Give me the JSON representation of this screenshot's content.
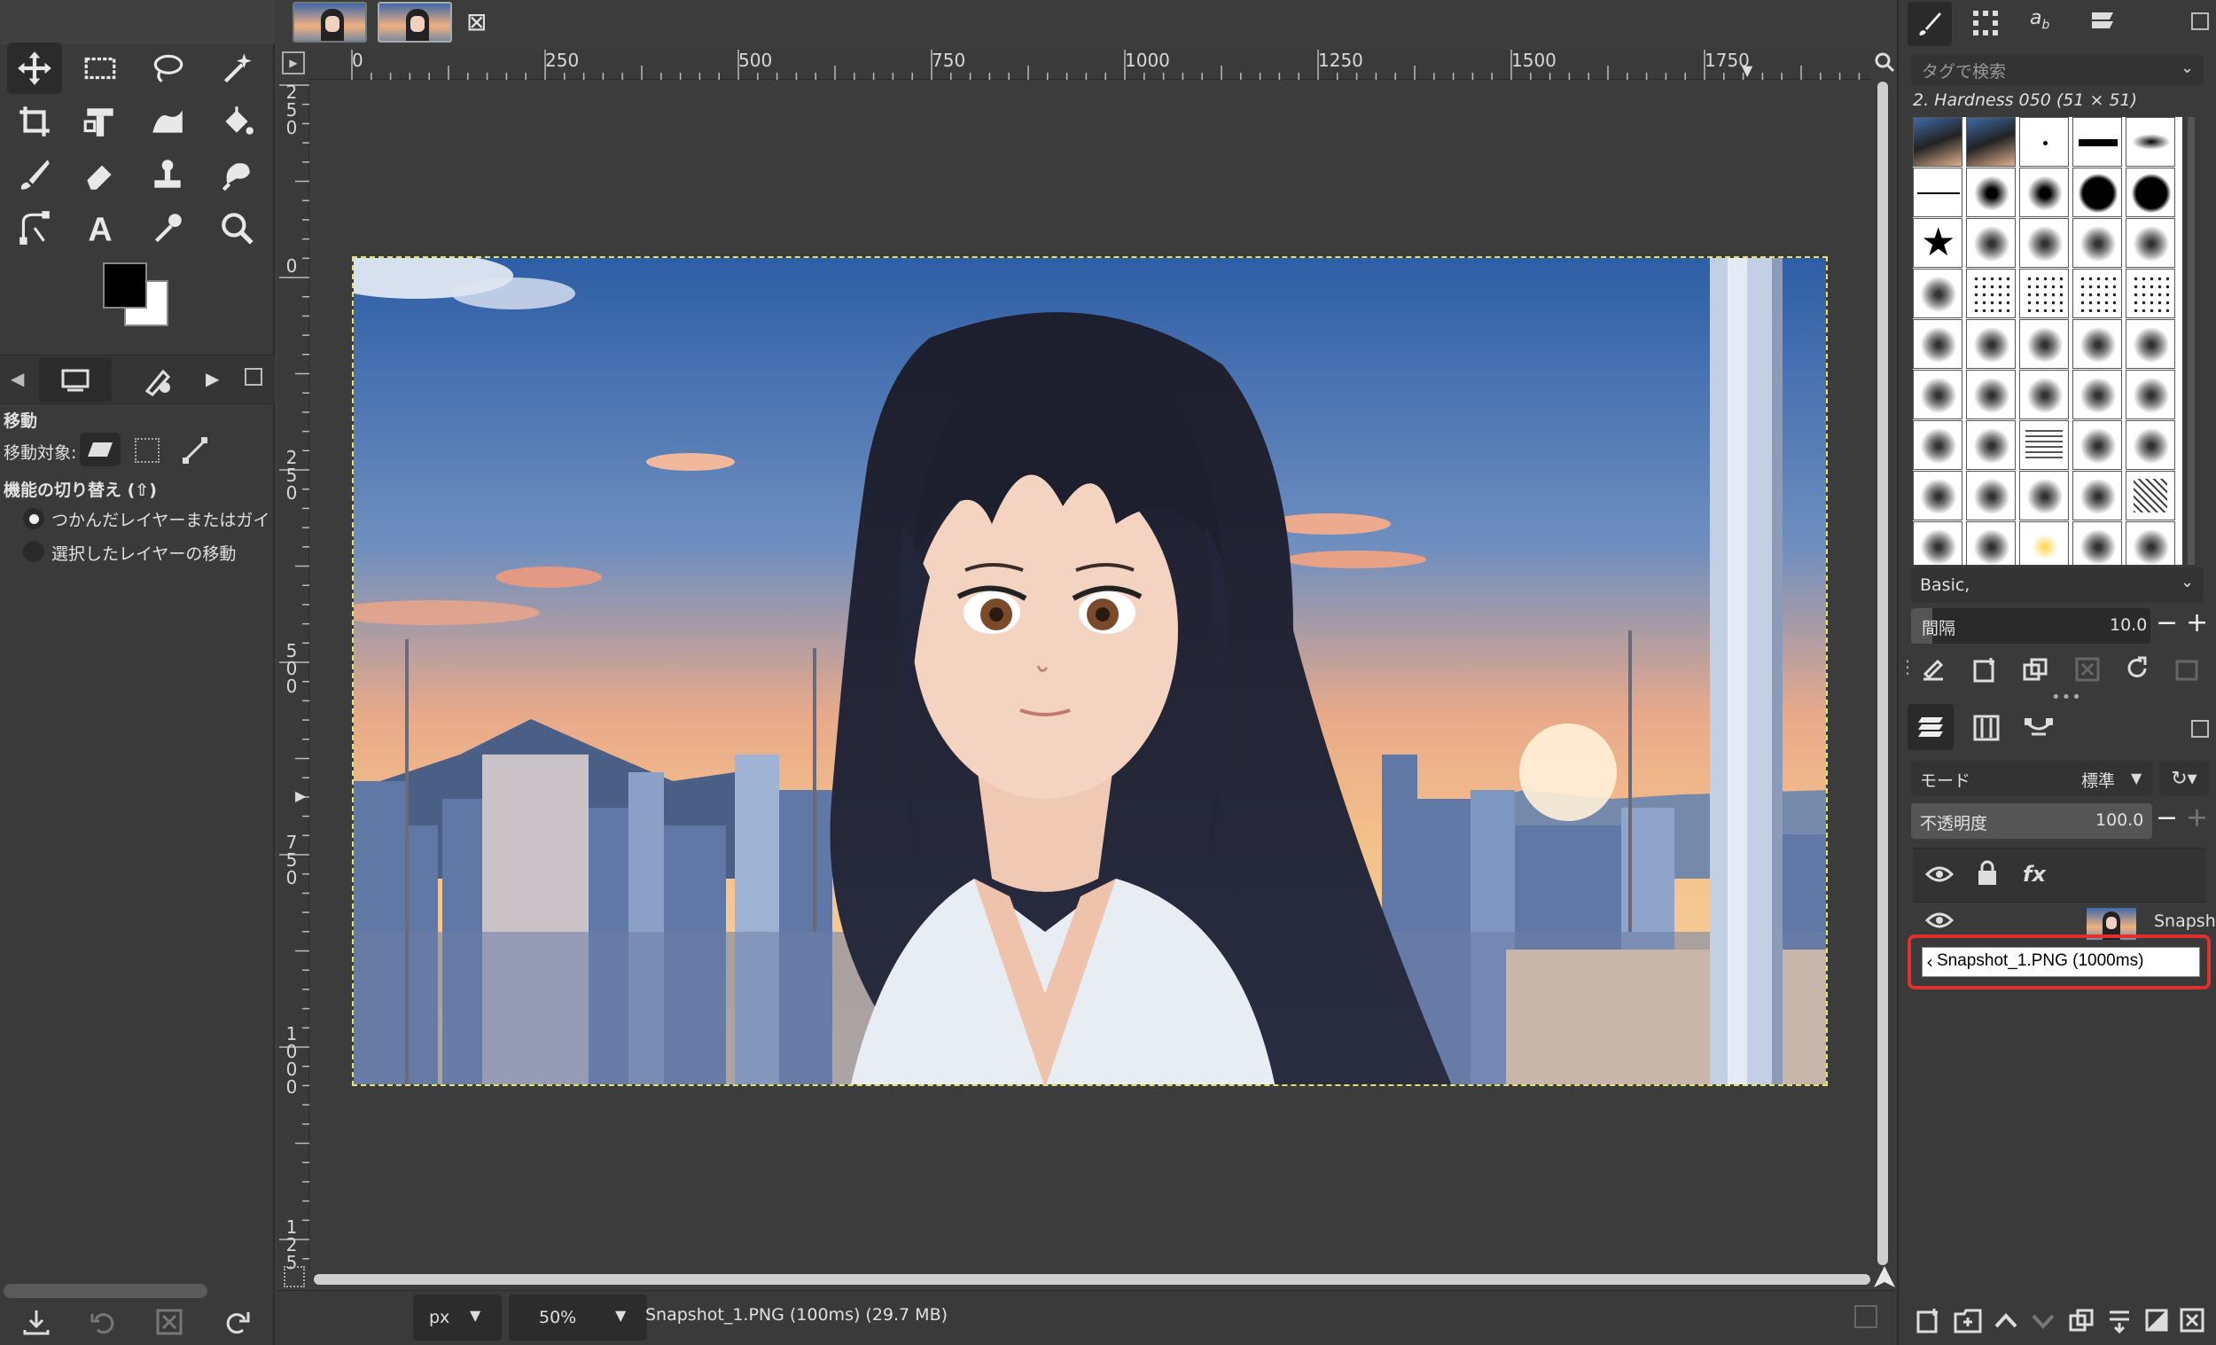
{
  "image_tabs": {
    "close_symbol": "⊠"
  },
  "rulers": {
    "h_labels": [
      "0",
      "250",
      "500",
      "750",
      "1000",
      "1250",
      "1500",
      "1750"
    ],
    "v_labels": [
      "250",
      "0",
      "250",
      "500",
      "750",
      "1000",
      "125"
    ]
  },
  "tool_options": {
    "title": "移動",
    "move_target_label": "移動対象:",
    "toggle_label": "機能の切り替え (⇧)",
    "radio1": "つかんだレイヤーまたはガイ",
    "radio2": "選択したレイヤーの移動"
  },
  "brushes": {
    "search_placeholder": "タグで検索",
    "current_brush": "2. Hardness 050 (51 × 51)",
    "preset": "Basic,",
    "spacing_label": "間隔",
    "spacing_value": "10.0"
  },
  "layers": {
    "mode_label": "モード",
    "mode_value": "標準",
    "opacity_label": "不透明度",
    "opacity_value": "100.0",
    "layer_name_short": "Snapshot",
    "edit_value": "Snapshot_1.PNG (1000ms)"
  },
  "status": {
    "unit": "px",
    "zoom": "50%",
    "info": "Snapshot_1.PNG (100ms) (29.7 MB)"
  },
  "colors": {
    "highlight": "#e03030",
    "accent": "#e5e06a"
  }
}
